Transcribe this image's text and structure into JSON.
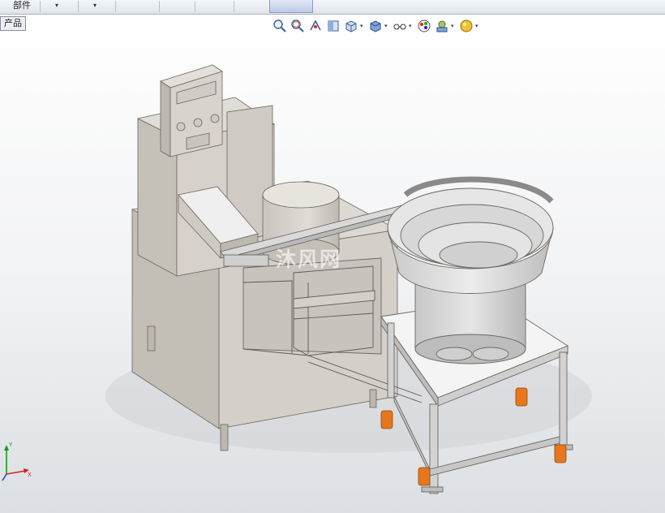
{
  "toolbar": {
    "assembly_tab_label": "部件",
    "caret": "▾"
  },
  "feature_tree": {
    "tab_label": "产品"
  },
  "view_toolbar": {
    "icons": [
      "zoom-to-fit-icon",
      "zoom-to-area-icon",
      "previous-view-icon",
      "section-view-icon",
      "view-orientation-icon",
      "display-style-icon",
      "hide-show-items-icon",
      "edit-appearance-icon",
      "apply-scene-icon",
      "view-settings-icon"
    ]
  },
  "watermark": {
    "text": "沐风网"
  },
  "triad": {
    "x_label": "X",
    "y_label": "Y"
  },
  "colors": {
    "machine_body": "#cdc8c1",
    "machine_shadow": "#a9a49c",
    "bowl": "#d9d9d9",
    "caster_orange": "#e8761c",
    "active_button": "#c9d3ea"
  }
}
